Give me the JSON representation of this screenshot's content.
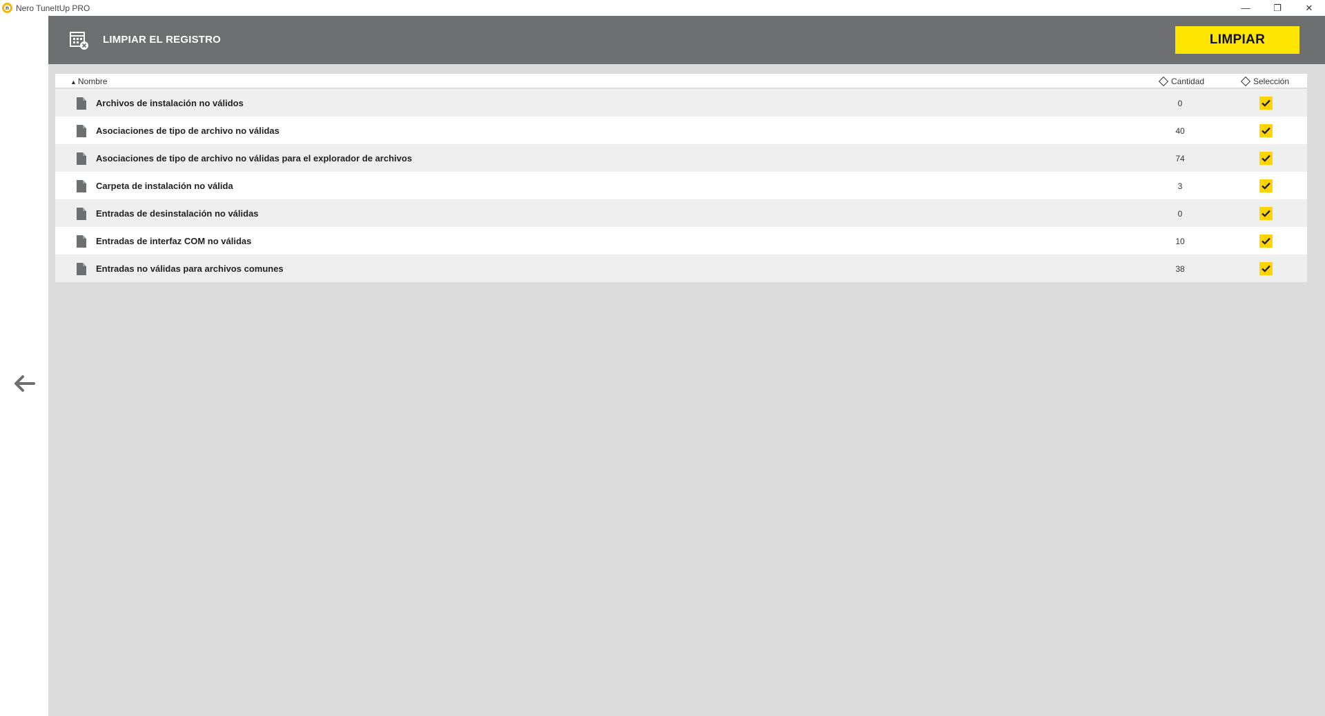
{
  "window": {
    "title": "Nero TuneItUp PRO",
    "logo_letter": "n",
    "minimize_glyph": "—",
    "restore_glyph": "❐",
    "close_glyph": "✕"
  },
  "header": {
    "title": "LIMPIAR EL REGISTRO",
    "clean_button": "LIMPIAR",
    "icon": "registry-clean-icon"
  },
  "colors": {
    "header_bg": "#6e6f71",
    "accent": "#ffe500",
    "content_bg": "#dcdcdc"
  },
  "table": {
    "columns": {
      "name": "Nombre",
      "quantity": "Cantidad",
      "selection": "Selección"
    },
    "sort_indicator": "▲",
    "rows": [
      {
        "label": "Archivos de instalación no válidos",
        "count": "0",
        "selected": true
      },
      {
        "label": "Asociaciones de tipo de archivo no válidas",
        "count": "40",
        "selected": true
      },
      {
        "label": "Asociaciones de tipo de archivo no válidas para el explorador de archivos",
        "count": "74",
        "selected": true
      },
      {
        "label": "Carpeta de instalación no válida",
        "count": "3",
        "selected": true
      },
      {
        "label": "Entradas de desinstalación no válidas",
        "count": "0",
        "selected": true
      },
      {
        "label": "Entradas de interfaz COM no válidas",
        "count": "10",
        "selected": true
      },
      {
        "label": "Entradas no válidas para archivos comunes",
        "count": "38",
        "selected": true
      }
    ]
  }
}
